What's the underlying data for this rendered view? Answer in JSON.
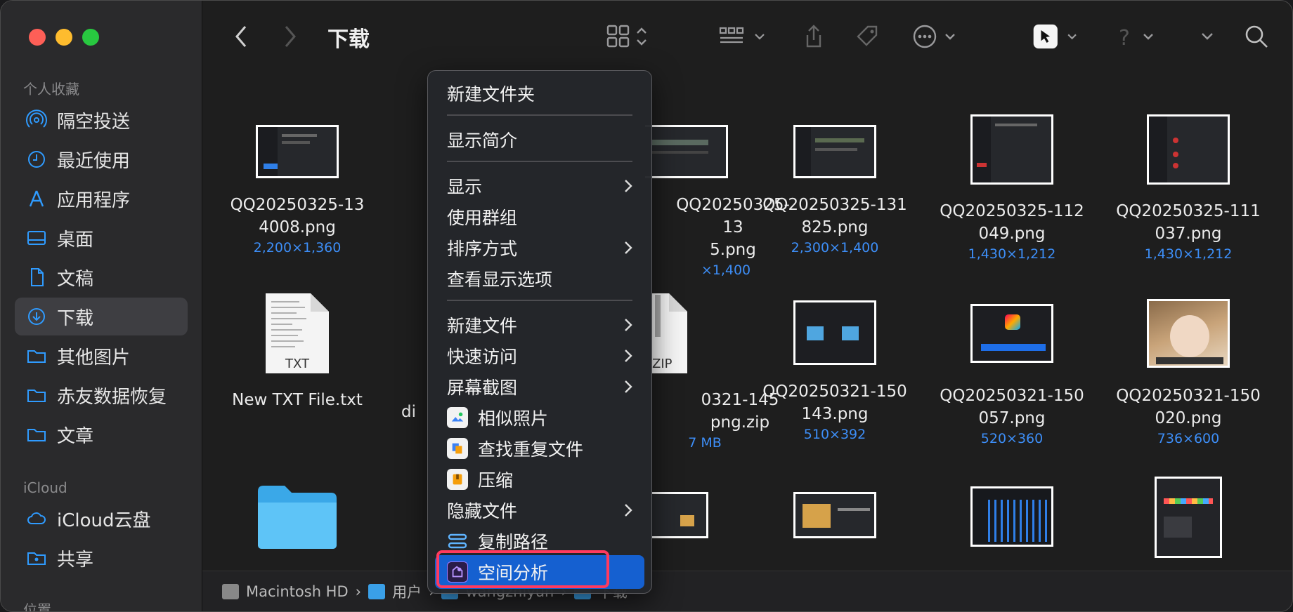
{
  "window": {
    "title": "下载"
  },
  "sidebar": {
    "favorites_header": "个人收藏",
    "favorites": [
      {
        "label": "隔空投送",
        "icon": "airdrop-icon"
      },
      {
        "label": "最近使用",
        "icon": "clock-icon"
      },
      {
        "label": "应用程序",
        "icon": "apps-icon"
      },
      {
        "label": "桌面",
        "icon": "desktop-icon"
      },
      {
        "label": "文稿",
        "icon": "document-icon"
      },
      {
        "label": "下载",
        "icon": "download-icon"
      },
      {
        "label": "其他图片",
        "icon": "folder-icon"
      },
      {
        "label": "赤友数据恢复",
        "icon": "folder-icon"
      },
      {
        "label": "文章",
        "icon": "folder-icon"
      }
    ],
    "icloud_header": "iCloud",
    "icloud": [
      {
        "label": "iCloud云盘",
        "icon": "cloud-icon"
      },
      {
        "label": "共享",
        "icon": "shared-folder-icon"
      }
    ],
    "locations_header": "位置"
  },
  "files": [
    {
      "name": "QQ20250325-13\n4008.png",
      "meta": "2,200×1,360"
    },
    {
      "name": "QQ20250325-13\n5.png",
      "meta": "×1,400"
    },
    {
      "name": "QQ20250325-131\n825.png",
      "meta": "2,300×1,400"
    },
    {
      "name": "QQ20250325-112\n049.png",
      "meta": "1,430×1,212"
    },
    {
      "name": "QQ20250325-111\n037.png",
      "meta": "1,430×1,212"
    },
    {
      "name": "New TXT File.txt",
      "meta": ""
    },
    {
      "name": "di",
      "meta": ""
    },
    {
      "name": "0321-145\npng.zip",
      "meta": "7 MB"
    },
    {
      "name": "QQ20250321-150\n143.png",
      "meta": "510×392"
    },
    {
      "name": "QQ20250321-150\n057.png",
      "meta": "520×360"
    },
    {
      "name": "QQ20250321-150\n020.png",
      "meta": "736×600"
    }
  ],
  "file_badges": {
    "txt": "TXT",
    "zip": "ZIP"
  },
  "pathbar": [
    "Macintosh HD",
    "用户",
    "wangzhiyun",
    "下载"
  ],
  "context_menu": {
    "items": [
      {
        "label": "新建文件夹"
      },
      {
        "label": "显示简介"
      },
      {
        "label": "显示",
        "submenu": true
      },
      {
        "label": "使用群组"
      },
      {
        "label": "排序方式",
        "submenu": true
      },
      {
        "label": "查看显示选项"
      },
      {
        "label": "新建文件",
        "submenu": true
      },
      {
        "label": "快速访问",
        "submenu": true
      },
      {
        "label": "屏幕截图",
        "submenu": true
      },
      {
        "label": "相似照片",
        "icon": "similar-photos-icon"
      },
      {
        "label": "查找重复文件",
        "icon": "duplicate-finder-icon"
      },
      {
        "label": "压缩",
        "icon": "compress-icon"
      },
      {
        "label": "隐藏文件",
        "submenu": true
      },
      {
        "label": "复制路径",
        "icon": "copy-path-icon"
      },
      {
        "label": "空间分析",
        "icon": "space-analysis-icon",
        "highlighted": true
      }
    ]
  },
  "colors": {
    "accent": "#1560d0",
    "highlight_outline": "#ff3a5e",
    "meta_text": "#3d8ef7"
  }
}
